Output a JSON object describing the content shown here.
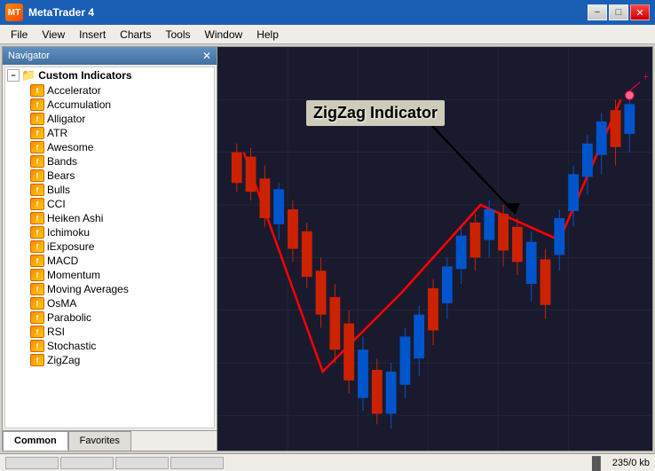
{
  "titleBar": {
    "title": "MetaTrader 4",
    "minimizeLabel": "−",
    "maximizeLabel": "□",
    "closeLabel": "✕"
  },
  "menuBar": {
    "items": [
      "File",
      "View",
      "Insert",
      "Charts",
      "Tools",
      "Window",
      "Help"
    ]
  },
  "navigator": {
    "title": "Navigator",
    "closeLabel": "✕",
    "expandLabel": "−",
    "indicators": {
      "label": "Custom Indicators",
      "children": [
        "Accelerator",
        "Accumulation",
        "Alligator",
        "ATR",
        "Awesome",
        "Bands",
        "Bears",
        "Bulls",
        "CCI",
        "Heiken Ashi",
        "Ichimoku",
        "iExposure",
        "MACD",
        "Momentum",
        "Moving Averages",
        "OsMA",
        "Parabolic",
        "RSI",
        "Stochastic",
        "ZigZag"
      ]
    },
    "tabs": [
      "Common",
      "Favorites"
    ]
  },
  "chart": {
    "annotation": "ZigZag Indicator"
  },
  "statusBar": {
    "sizeText": "235/0 kb"
  }
}
